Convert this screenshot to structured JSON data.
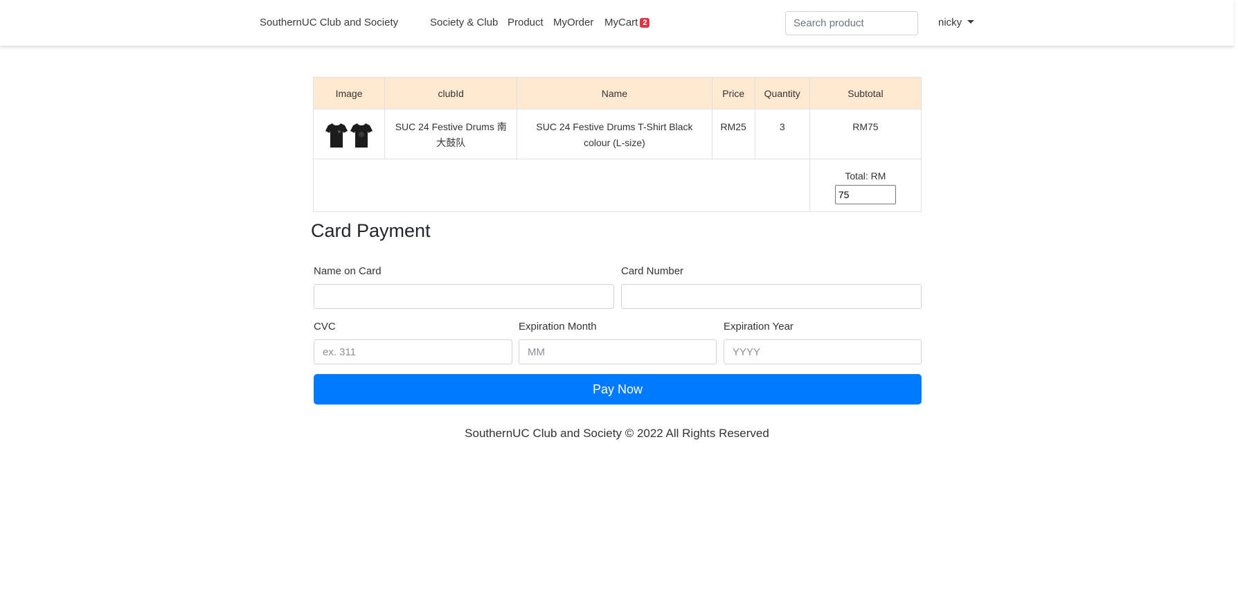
{
  "navbar": {
    "brand": "SouthernUC Club and Society",
    "links": [
      "Society & Club",
      "Product",
      "MyOrder",
      "MyCart"
    ],
    "cart_count": "2",
    "search_placeholder": "Search product",
    "user": "nicky"
  },
  "cart": {
    "headers": [
      "Image",
      "clubId",
      "Name",
      "Price",
      "Quantity",
      "Subtotal"
    ],
    "items": [
      {
        "image_icon": "tshirt-pair-icon",
        "clubId": "SUC 24 Festive Drums 南大鼓队",
        "name": "SUC 24 Festive Drums T-Shirt Black colour (L-size)",
        "price": "RM25",
        "quantity": "3",
        "subtotal": "RM75"
      }
    ],
    "total_label": "Total: RM",
    "total_value": "75"
  },
  "payment": {
    "title": "Card Payment",
    "name_label": "Name on Card",
    "name_value": "",
    "number_label": "Card Number",
    "number_value": "",
    "cvc_label": "CVC",
    "cvc_placeholder": "ex. 311",
    "month_label": "Expiration Month",
    "month_placeholder": "MM",
    "year_label": "Expiration Year",
    "year_placeholder": "YYYY",
    "button": "Pay Now"
  },
  "footer": "SouthernUC Club and Society © 2022 All Rights Reserved",
  "colors": {
    "primary": "#007bff",
    "badge": "#dc3545",
    "table_header": "#ffe9d1"
  }
}
